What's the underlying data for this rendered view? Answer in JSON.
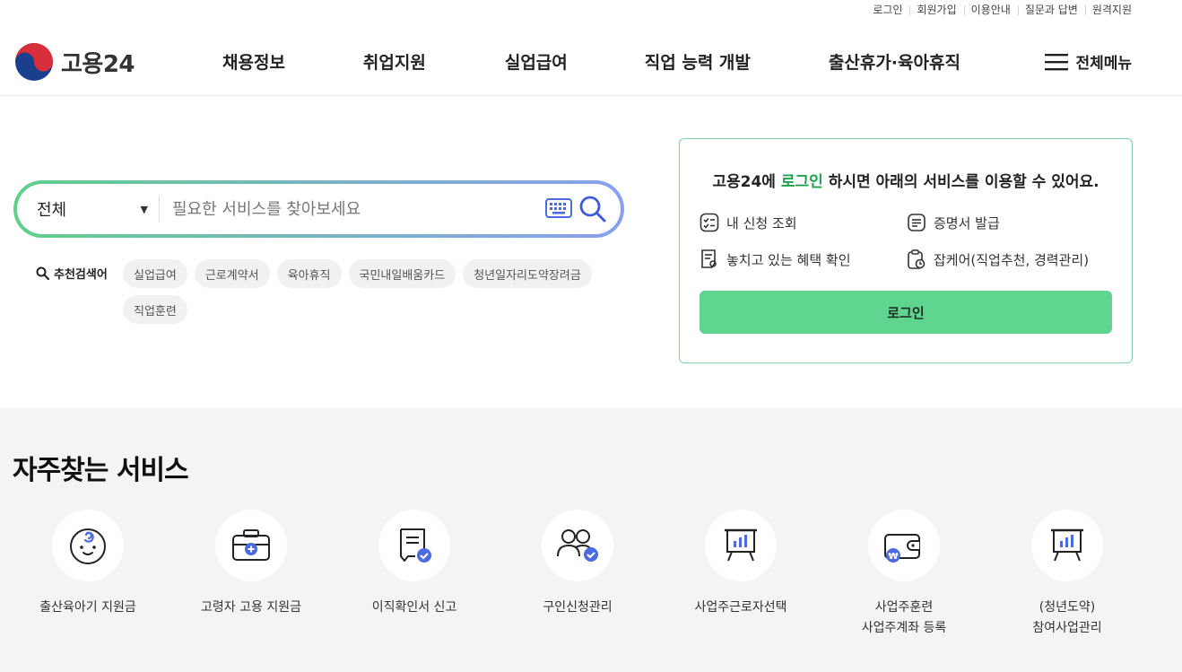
{
  "util_links": [
    "로그인",
    "회원가입",
    "이용안내",
    "질문과 답변",
    "원격지원"
  ],
  "logo": {
    "text": "고용24"
  },
  "gnb": [
    "채용정보",
    "취업지원",
    "실업급여",
    "직업 능력 개발",
    "출산휴가·육아휴직"
  ],
  "all_menu": "전체메뉴",
  "search": {
    "scope": "전체",
    "placeholder": "필요한 서비스를 찾아보세요"
  },
  "recommend": {
    "label": "추천검색어",
    "keywords": [
      "실업급여",
      "근로계약서",
      "육아휴직",
      "국민내일배움카드",
      "청년일자리도약장려금",
      "직업훈련"
    ]
  },
  "login_box": {
    "title_pre": "고용24에 ",
    "title_hl": "로그인",
    "title_post": " 하시면 아래의 서비스를 이용할 수 있어요.",
    "services": [
      "내 신청 조회",
      "증명서 발급",
      "놓치고 있는 혜택 확인",
      "잡케어(직업추천, 경력관리)"
    ],
    "button": "로그인"
  },
  "frequent": {
    "title": "자주찾는 서비스",
    "items": [
      {
        "label": "출산육아기 지원금",
        "icon": "baby-face-icon"
      },
      {
        "label": "고령자 고용 지원금",
        "icon": "medical-briefcase-icon"
      },
      {
        "label": "이직확인서 신고",
        "icon": "certificate-check-icon"
      },
      {
        "label": "구인신청관리",
        "icon": "people-check-icon"
      },
      {
        "label": "사업주근로자선택",
        "icon": "chart-board-icon"
      },
      {
        "label": "사업주훈련\n사업주계좌 등록",
        "icon": "wallet-won-icon"
      },
      {
        "label": "(청년도약)\n참여사업관리",
        "icon": "chart-board-icon"
      }
    ]
  },
  "colors": {
    "accent": "#5fd590",
    "brand_blue": "#1a3f8c",
    "brand_red": "#d72f3c",
    "icon_blue": "#4d6be0"
  }
}
